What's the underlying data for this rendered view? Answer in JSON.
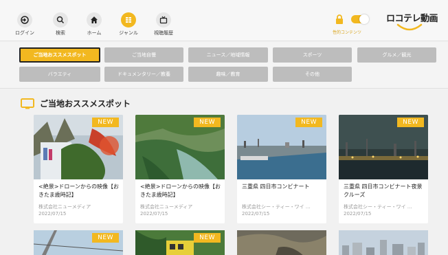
{
  "nav": {
    "login": "ログイン",
    "search": "検索",
    "home": "ホーム",
    "genre": "ジャンル",
    "history": "視聴履歴"
  },
  "adult": {
    "label": "性的コンテンツ"
  },
  "logo": {
    "text": "ロコテレ動画"
  },
  "genres": {
    "row1": [
      "ご当地おススメスポット",
      "ご当地自慢",
      "ニュース／地域情報",
      "スポーツ",
      "グルメ／観光"
    ],
    "row2": [
      "バラエティ",
      "ドキュメンタリー／教養",
      "趣味／教育",
      "その他"
    ]
  },
  "section": {
    "title": "ご当地おススメスポット"
  },
  "cards": [
    {
      "badge": "NEW",
      "title": "<絶景>ドローンからの映像【おきたま歳時記】",
      "publisher": "株式会社ニューメディア",
      "date": "2022/07/15"
    },
    {
      "badge": "NEW",
      "title": "<絶景>ドローンからの映像【おきたま歳時記】",
      "publisher": "株式会社ニューメディア",
      "date": "2022/07/15"
    },
    {
      "badge": "NEW",
      "title": "三重県 四日市コンビナート",
      "publisher": "株式会社シー・ティー・ワイ …",
      "date": "2022/07/15"
    },
    {
      "badge": "NEW",
      "title": "三重県 四日市コンビナート夜景クルーズ",
      "publisher": "株式会社シー・ティー・ワイ …",
      "date": "2022/07/15"
    }
  ],
  "cards_row2": [
    {
      "badge": "NEW"
    },
    {
      "badge": "NEW"
    }
  ],
  "colors": {
    "accent": "#f2b820",
    "genre_inactive": "#bdbdbd",
    "background": "#f1f1f1"
  }
}
